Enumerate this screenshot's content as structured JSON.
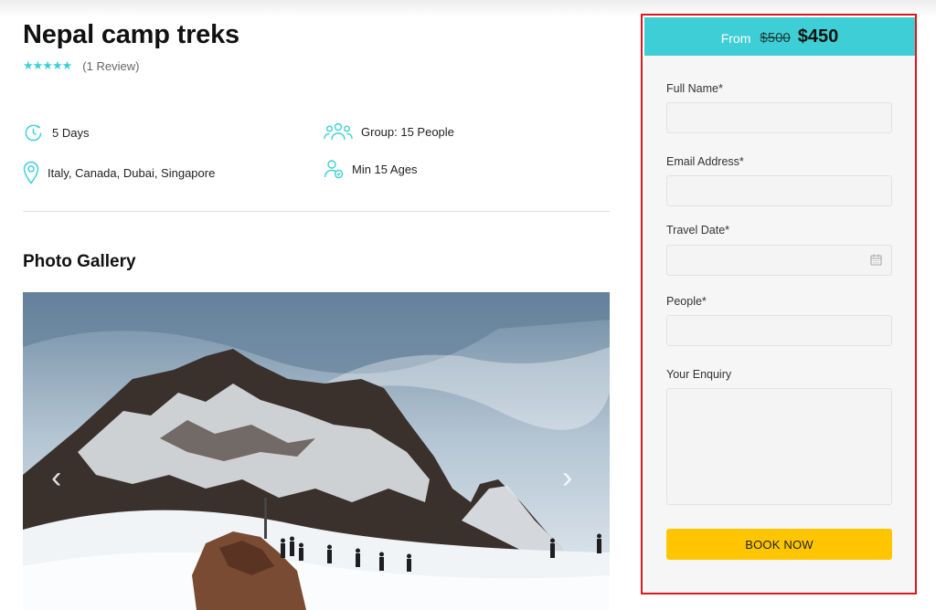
{
  "tour": {
    "title": "Nepal camp treks",
    "stars": "★★★★★",
    "review_count": "(1 Review)"
  },
  "info": {
    "duration": "5 Days",
    "group": "Group: 15 People",
    "locations": "Italy, Canada, Dubai, Singapore",
    "min_age": "Min 15 Ages"
  },
  "gallery": {
    "title": "Photo Gallery",
    "prev_arrow": "‹",
    "next_arrow": "›"
  },
  "booking": {
    "from_label": "From",
    "old_price": "$500",
    "new_price": "$450",
    "full_name_label": "Full Name*",
    "email_label": "Email Address*",
    "travel_date_label": "Travel Date*",
    "people_label": "People*",
    "enquiry_label": "Your Enquiry",
    "full_name_value": "",
    "email_value": "",
    "travel_date_value": "",
    "people_value": "",
    "enquiry_value": "",
    "book_button": "BOOK NOW"
  },
  "colors": {
    "accent": "#3ecfd6",
    "button": "#ffc600",
    "highlight_border": "#e3141b"
  },
  "icons": {
    "duration": "clock-icon",
    "group": "group-icon",
    "location": "map-pin-icon",
    "age": "user-age-icon",
    "calendar": "calendar-icon"
  }
}
